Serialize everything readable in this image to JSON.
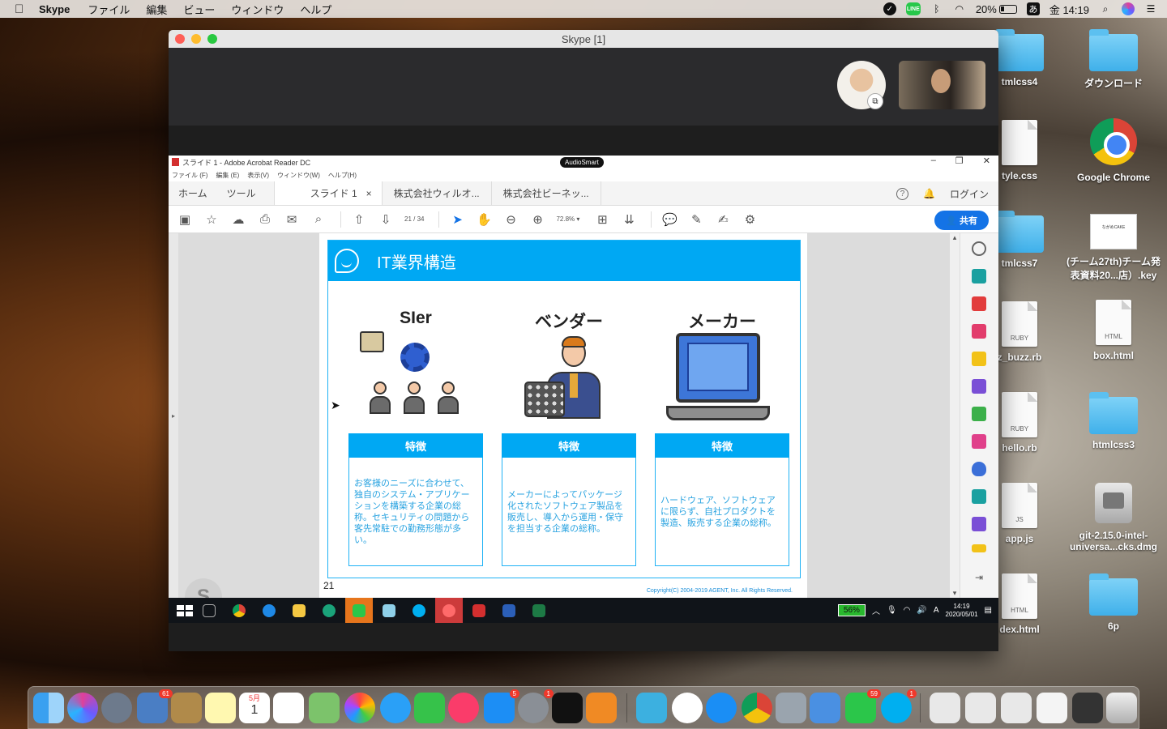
{
  "menubar": {
    "app_name": "Skype",
    "items": [
      "ファイル",
      "編集",
      "ビュー",
      "ウィンドウ",
      "ヘルプ"
    ],
    "line_label": "LINE",
    "battery": "20%",
    "ime": "あ",
    "clock": "金 14:19"
  },
  "desktop": {
    "icons": [
      {
        "label": "tmlcss4"
      },
      {
        "label": "ダウンロード"
      },
      {
        "label": "tyle.css"
      },
      {
        "label": "Google Chrome"
      },
      {
        "label": "tmlcss7"
      },
      {
        "label": "(チーム27th)チーム発表資料20...店）.key",
        "thumb": "ながめCAKE"
      },
      {
        "label": "z_buzz.rb",
        "type": "RUBY"
      },
      {
        "label": "box.html",
        "type": "HTML"
      },
      {
        "label": "hello.rb",
        "type": "RUBY"
      },
      {
        "label": "htmlcss3"
      },
      {
        "label": "app.js",
        "type": "JS"
      },
      {
        "label": "git-2.15.0-intel-universa...cks.dmg"
      },
      {
        "label": "dex.html",
        "type": "HTML"
      },
      {
        "label": "6p"
      }
    ]
  },
  "skype": {
    "window_title": "Skype [1]"
  },
  "acrobat": {
    "title": "スライド 1 - Adobe Acrobat Reader DC",
    "audiosmart": "AudioSmart",
    "menu": [
      "ファイル (F)",
      "編集 (E)",
      "表示(V)",
      "ウィンドウ(W)",
      "ヘルプ(H)"
    ],
    "tabs": {
      "home": "ホーム",
      "tools": "ツール",
      "active_doc": "スライド 1",
      "doc2": "株式会社ウィルオ...",
      "doc3": "株式会社ビーネッ...",
      "login": "ログイン"
    },
    "toolbar": {
      "page_current": "21",
      "page_total": "/ 34",
      "zoom": "72.8%",
      "share": "共有"
    }
  },
  "slide": {
    "header": "IT業界構造",
    "columns": [
      {
        "title": "SIer",
        "feature": "特徴",
        "desc": "お客様のニーズに合わせて、独自のシステム・アプリケーションを構築する企業の総称。セキュリティの問題から客先常駐での勤務形態が多い。"
      },
      {
        "title": "ベンダー",
        "feature": "特徴",
        "desc": "メーカーによってパッケージ化されたソフトウェア製品を販売し、導入から運用・保守を担当する企業の総称。"
      },
      {
        "title": "メーカー",
        "feature": "特徴",
        "desc": "ハードウェア、ソフトウェアに限らず、自社プロダクトを製造、販売する企業の総称。"
      }
    ],
    "page_number": "21",
    "copyright": "Copyright(C) 2004-2019 AGENT, Inc. All Rights Reserved."
  },
  "win_taskbar": {
    "battery": "56%",
    "time": "14:19",
    "date": "2020/05/01",
    "ime": "A"
  },
  "dock": {
    "badges": {
      "mail_like": "61",
      "calendar_month": "5月",
      "calendar_day": "1",
      "appstore": "5",
      "prefs": "1",
      "line": "59",
      "skype": "1"
    }
  }
}
